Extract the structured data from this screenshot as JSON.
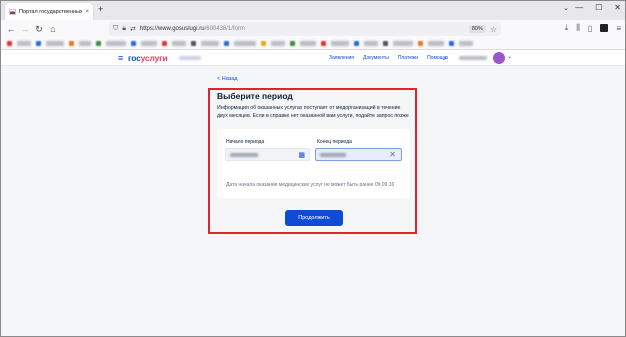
{
  "browser": {
    "tab_title": "Портал государственных услуг",
    "tab_close": "×",
    "new_tab": "+",
    "tab_list": "⌄",
    "window_controls": [
      "—",
      "☐",
      "✕"
    ],
    "url_host": "https://www.gosuslugi.ru",
    "url_path": "/600438/1/form",
    "zoom": "80%",
    "icons": [
      "back-icon",
      "forward-icon",
      "reload-icon",
      "home-icon",
      "shield-icon",
      "lock-icon",
      "star-icon",
      "downloads-icon",
      "library-icon",
      "sidebar-icon",
      "extension-icon",
      "menu-icon"
    ]
  },
  "site": {
    "logo_part1": "гос",
    "logo_part2": "услуги",
    "menu": [
      "Заявления",
      "Документы",
      "Платежи",
      "Помощь"
    ],
    "colors": {
      "brand_blue": "#0d4cd3",
      "brand_red": "#ee3f58",
      "highlight_frame": "#e0232e",
      "avatar": "#9b57c8"
    }
  },
  "page": {
    "back_label": "< Назад",
    "title": "Выберите период",
    "info_text": "Информация об оказанных услугах поступает от медорганизаций в течение двух месяцев. Если в справке нет оказанной вам услуги, подайте запрос позже",
    "start_label": "Начало периода",
    "end_label": "Конец периода",
    "note": "Дата начала оказания медицинских услуг не может быть ранее 09.09.16",
    "continue_label": "Продолжить"
  }
}
